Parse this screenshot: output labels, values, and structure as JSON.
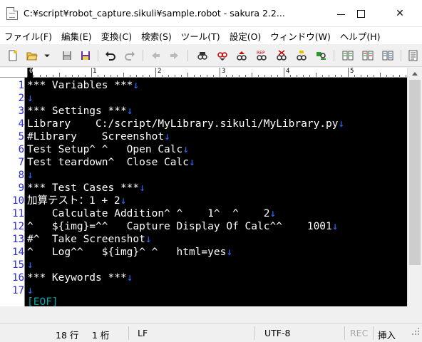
{
  "window": {
    "title": "C:¥script¥robot_capture.sikuli¥sample.robot - sakura 2.2...",
    "minimize_icon": "minimize-icon",
    "maximize_icon": "maximize-icon",
    "close_glyph": "✕"
  },
  "menu": [
    "ファイル(F)",
    "編集(E)",
    "変換(C)",
    "検索(S)",
    "ツール(T)",
    "設定(O)",
    "ウィンドウ(W)",
    "ヘルプ(H)"
  ],
  "toolbar_icons": [
    "new-file-icon",
    "open-folder-icon",
    "dropdown-icon",
    "save-icon",
    "save-all-icon",
    "undo-icon",
    "redo-icon",
    "jump-prev-icon",
    "jump-next-icon",
    "search-icon",
    "search-prev-icon",
    "search-next-icon",
    "replace-icon",
    "clear-search-icon",
    "grep-icon",
    "bookmark-icon",
    "compare-icon",
    "outline-icon",
    "split-icon",
    "settings-icon"
  ],
  "ruler": {
    "labels": [
      "0",
      "1",
      "2",
      "3",
      "4",
      "5"
    ]
  },
  "editor": {
    "lines": [
      {
        "no": "1",
        "text": "*** Variables ***",
        "ret": "↓"
      },
      {
        "no": "2",
        "text": "",
        "ret": "↓"
      },
      {
        "no": "3",
        "text": "*** Settings ***",
        "ret": "↓"
      },
      {
        "no": "4",
        "text": "Library    C:/script/MyLibrary.sikuli/MyLibrary.py",
        "ret": "↓"
      },
      {
        "no": "5",
        "text": "#Library    Screenshot",
        "ret": "↓"
      },
      {
        "no": "6",
        "text": "Test Setup^ ^   Open Calc",
        "ret": "↓"
      },
      {
        "no": "7",
        "text": "Test teardown^  Close Calc",
        "ret": "↓"
      },
      {
        "no": "8",
        "text": "",
        "ret": "↓"
      },
      {
        "no": "9",
        "text": "*** Test Cases ***",
        "ret": "↓"
      },
      {
        "no": "10",
        "text": "加算テスト：1 + 2",
        "ret": "↓"
      },
      {
        "no": "11",
        "text": "    Calculate Addition^ ^    1^  ^    2",
        "ret": "↓"
      },
      {
        "no": "12",
        "text": "^   ${img}=^^   Capture Display Of Calc^^    1001",
        "ret": "↓"
      },
      {
        "no": "13",
        "text": "#^  Take Screenshot",
        "ret": "↓"
      },
      {
        "no": "14",
        "text": "^   Log^^   ${img}^ ^   html=yes",
        "ret": "↓"
      },
      {
        "no": "15",
        "text": "",
        "ret": "↓"
      },
      {
        "no": "16",
        "text": "*** Keywords ***",
        "ret": "↓"
      },
      {
        "no": "17",
        "text": "",
        "ret": "↓"
      }
    ],
    "eof": "[EOF]"
  },
  "status": {
    "line": "18 行",
    "col": "1 桁",
    "eol": "LF",
    "encoding": "UTF-8",
    "rec": "REC",
    "mode": "挿入"
  }
}
